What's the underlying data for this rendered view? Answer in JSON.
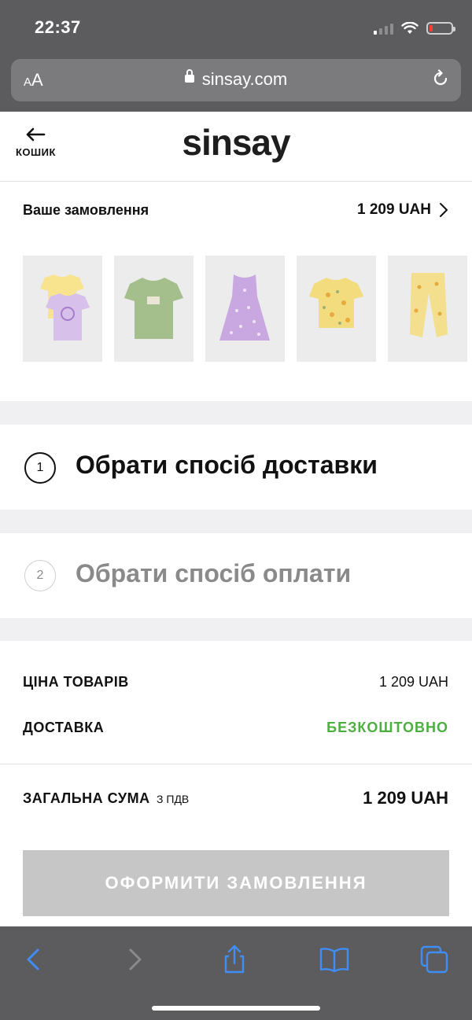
{
  "status_bar": {
    "time": "22:37"
  },
  "browser": {
    "aa_small": "A",
    "aa_large": "A",
    "url": "sinsay.com"
  },
  "header": {
    "back_label": "КОШИК",
    "logo": "sinsay"
  },
  "order": {
    "title": "Ваше замовлення",
    "total": "1 209 UAH",
    "items": [
      {
        "icon": "tshirt-set-icon"
      },
      {
        "icon": "green-tshirt-icon"
      },
      {
        "icon": "lilac-dress-icon"
      },
      {
        "icon": "yellow-floral-tshirt-icon"
      },
      {
        "icon": "yellow-leggings-icon"
      }
    ]
  },
  "steps": [
    {
      "number": "1",
      "title": "Обрати спосіб доставки",
      "active": true
    },
    {
      "number": "2",
      "title": "Обрати спосіб оплати",
      "active": false
    }
  ],
  "summary": {
    "goods_label": "ЦІНА ТОВАРІВ",
    "goods_value": "1 209 UAH",
    "delivery_label": "ДОСТАВКА",
    "delivery_value": "БЕЗКОШТОВНО",
    "total_label": "ЗАГАЛЬНА СУМА",
    "total_note": "З ПДВ",
    "total_value": "1 209 UAH"
  },
  "checkout_button": "ОФОРМИТИ ЗАМОВЛЕННЯ",
  "colors": {
    "accent_free": "#4caf3f",
    "button_disabled": "#c6c6c6",
    "chrome": "#5c5c5e",
    "toolbar_icon": "#3f8ef5"
  },
  "toolbar": [
    "back-icon",
    "forward-icon",
    "share-icon",
    "bookmarks-icon",
    "tabs-icon"
  ]
}
